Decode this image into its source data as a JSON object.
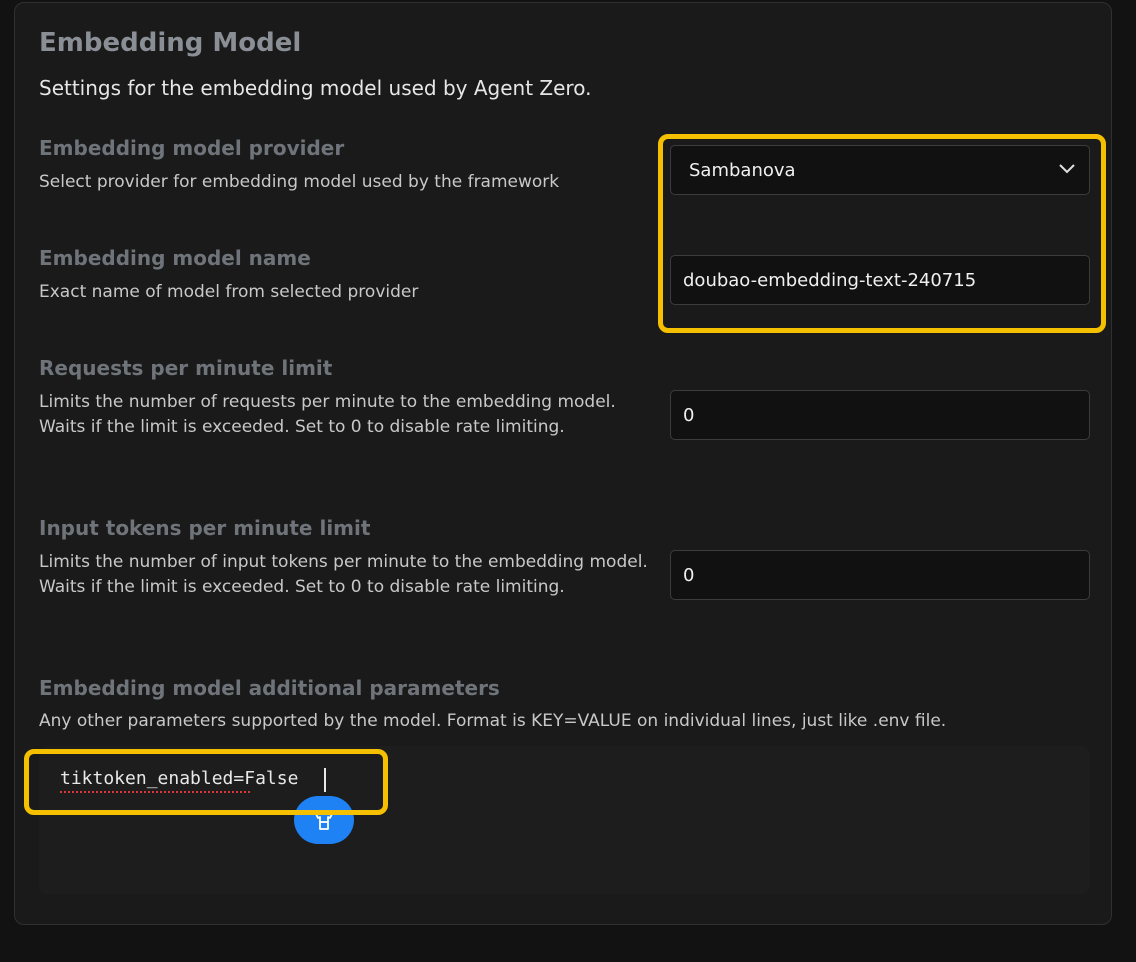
{
  "section": {
    "title": "Embedding Model",
    "description": "Settings for the embedding model used by Agent Zero."
  },
  "fields": {
    "provider": {
      "title": "Embedding model provider",
      "description": "Select provider for embedding model used by the framework",
      "value": "Sambanova"
    },
    "model_name": {
      "title": "Embedding model name",
      "description": "Exact name of model from selected provider",
      "value": "doubao-embedding-text-240715"
    },
    "rpm": {
      "title": "Requests per minute limit",
      "description": "Limits the number of requests per minute to the embedding model. Waits if the limit is exceeded. Set to 0 to disable rate limiting.",
      "value": "0"
    },
    "tpm": {
      "title": "Input tokens per minute limit",
      "description": "Limits the number of input tokens per minute to the embedding model. Waits if the limit is exceeded. Set to 0 to disable rate limiting.",
      "value": "0"
    },
    "additional": {
      "title": "Embedding model additional parameters",
      "description": "Any other parameters supported by the model. Format is KEY=VALUE on individual lines, just like .env file.",
      "value": "tiktoken_enabled=False"
    }
  },
  "colors": {
    "highlight": "#f5c000",
    "fab": "#1e82f5"
  },
  "icons": {
    "select_chevron": "chevron-down-icon",
    "fab_icon": "shirt-icon"
  }
}
